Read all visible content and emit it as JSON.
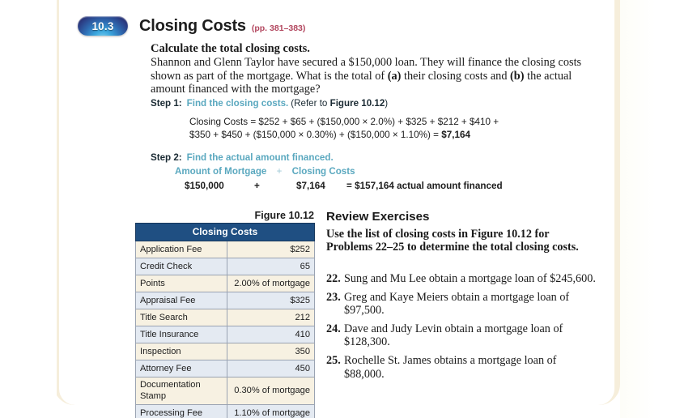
{
  "header": {
    "section_number": "10.3",
    "title": "Closing Costs",
    "pages_ref": "(pp. 381–383)",
    "badge_color": "#2b3f86",
    "pages_ref_color": "#b2465e"
  },
  "problem": {
    "directive": "Calculate the total closing costs.",
    "body_line_1": "Shannon and Glenn Taylor have secured a $150,000 loan. They will finance the closing",
    "body_line_2_a": "costs shown as part of the mortgage. What is the total of ",
    "body_line_2_b": "(a)",
    "body_line_2_c": " their closing costs and ",
    "body_line_2_d": "(b)",
    "body_line_3": "the actual amount financed with the mortgage?"
  },
  "steps": {
    "accent_color": "#5aa8bf",
    "step1": {
      "label": "Step 1:",
      "text": "Find the closing costs.",
      "paren_prefix": "(Refer to ",
      "paren_bold": "Figure 10.12",
      "paren_suffix": ")",
      "formula_line_1": "Closing Costs = $252 + $65 + ($150,000 × 2.0%) + $325 + $212 + $410 +",
      "formula_line_2_a": "$350 + $450 + ($150,000 × 0.30%) + ($150,000 × 1.10%) = ",
      "formula_line_2_total": "$7,164"
    },
    "step2": {
      "label": "Step 2:",
      "text": "Find the actual amount financed.",
      "header_left": "Amount of Mortgage",
      "header_plus": "+",
      "header_right": "Closing Costs",
      "value_left": "$150,000",
      "value_plus": "+",
      "value_right": "$7,164",
      "value_equals": "= $157,164 actual amount financed"
    }
  },
  "figure": {
    "caption": "Figure 10.12",
    "table": {
      "header": "Closing Costs",
      "header_bg": "#1f4f82",
      "row_color_a": "#f7f1e2",
      "row_color_b": "#e4eaf2",
      "rows": [
        {
          "label": "Application Fee",
          "value": "$252"
        },
        {
          "label": "Credit Check",
          "value": "65"
        },
        {
          "label": "Points",
          "value": "2.00% of mortgage"
        },
        {
          "label": "Appraisal Fee",
          "value": "$325"
        },
        {
          "label": "Title Search",
          "value": "212"
        },
        {
          "label": "Title Insurance",
          "value": "410"
        },
        {
          "label": "Inspection",
          "value": "350"
        },
        {
          "label": "Attorney Fee",
          "value": "450"
        },
        {
          "label": "Documentation Stamp",
          "value": "0.30% of mortgage"
        },
        {
          "label": "Processing Fee",
          "value": "1.10% of mortgage"
        }
      ]
    }
  },
  "review": {
    "title": "Review Exercises",
    "intro_line_1": "Use the list of closing costs in Figure 10.12",
    "intro_line_2": "for Problems 22–25 to determine the total",
    "intro_line_3": "closing costs.",
    "problems": [
      {
        "number": "22.",
        "text": "Sung and Mu Lee obtain a mortgage loan of $245,600."
      },
      {
        "number": "23.",
        "text": "Greg and Kaye Meiers obtain a mortgage loan of $97,500."
      },
      {
        "number": "24.",
        "text": "Dave and Judy Levin obtain a mortgage loan of $128,300."
      },
      {
        "number": "25.",
        "text": "Rochelle St. James obtains a mortgage loan of $88,000."
      }
    ]
  }
}
